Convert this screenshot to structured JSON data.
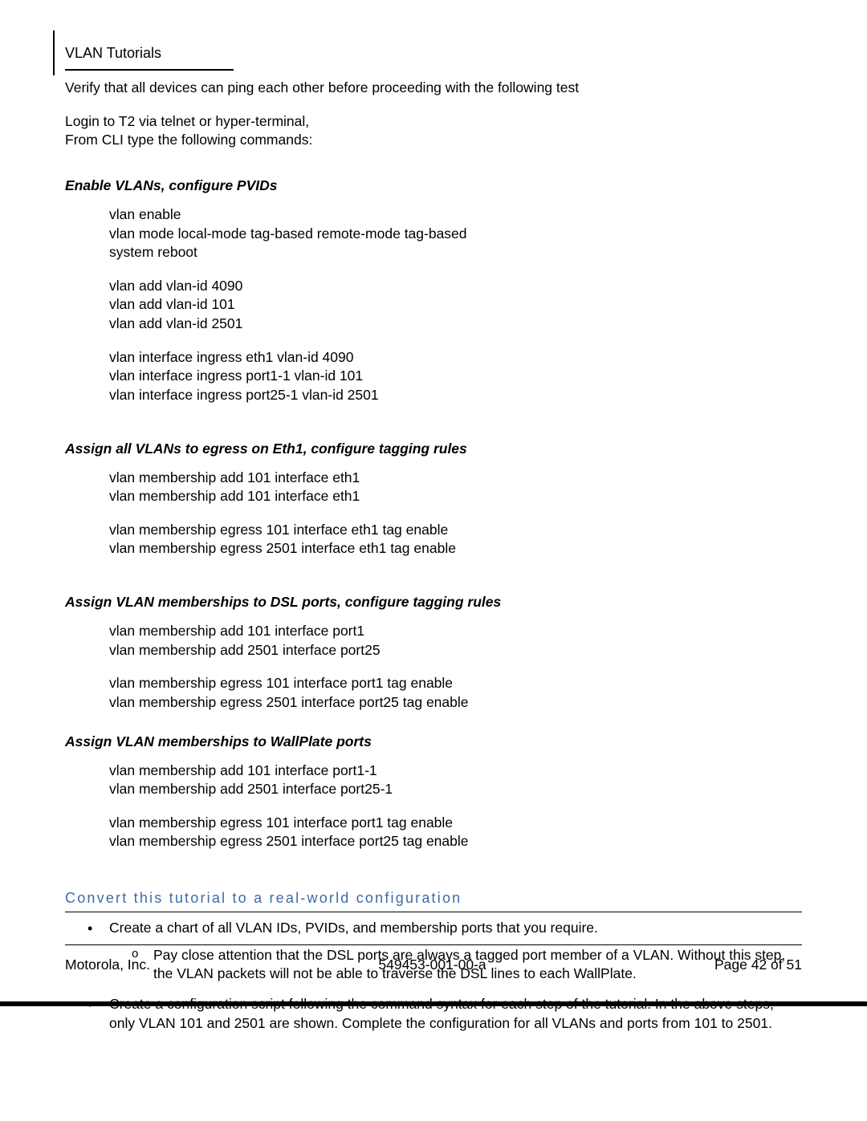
{
  "header": {
    "title": "VLAN Tutorials"
  },
  "intro": {
    "verify": "Verify that all devices can ping each other before proceeding with the following test",
    "login1": "Login to T2 via telnet or hyper-terminal,",
    "login2": "From CLI type the following commands:"
  },
  "sections": [
    {
      "heading": "Enable VLANs, configure PVIDs",
      "blocks": [
        [
          "vlan enable",
          "vlan mode local-mode tag-based remote-mode tag-based",
          "system reboot"
        ],
        [
          "vlan add vlan-id 4090",
          "vlan add vlan-id 101",
          "vlan add vlan-id 2501"
        ],
        [
          "vlan interface ingress eth1 vlan-id 4090",
          "vlan interface ingress port1-1 vlan-id 101",
          "vlan interface ingress port25-1 vlan-id 2501"
        ]
      ]
    },
    {
      "heading": "Assign all VLANs to egress on Eth1, configure tagging rules",
      "blocks": [
        [
          "vlan membership add 101 interface eth1",
          "vlan membership add 101 interface eth1"
        ],
        [
          "vlan membership egress 101 interface eth1 tag enable",
          "vlan membership egress 2501 interface eth1 tag enable"
        ]
      ]
    },
    {
      "heading": "Assign VLAN memberships to DSL ports, configure tagging rules",
      "blocks": [
        [
          "vlan membership add 101 interface port1",
          "vlan membership add 2501 interface port25"
        ],
        [
          "vlan membership egress 101 interface port1 tag enable",
          "vlan membership egress 2501 interface port25 tag enable"
        ]
      ]
    },
    {
      "heading": "Assign VLAN memberships to WallPlate ports",
      "blocks": [
        [
          "vlan membership add 101 interface port1-1",
          "vlan membership add 2501 interface port25-1"
        ],
        [
          "vlan membership egress 101 interface port1 tag enable",
          "vlan membership egress 2501 interface port25 tag enable"
        ]
      ]
    }
  ],
  "convert": {
    "heading": "Convert this tutorial to a real-world configuration",
    "bullets": [
      {
        "text": "Create a chart of all VLAN IDs, PVIDs, and membership ports that you require.",
        "sub": [
          "Pay close attention that the DSL ports are always a tagged port member of a VLAN.  Without this step, the VLAN packets will not be able to traverse the DSL lines to each WallPlate."
        ]
      },
      {
        "text": "Create a configuration script following the command syntax for each step of the tutorial.  In the above steps, only VLAN 101 and 2501 are shown.  Complete the configuration for all VLANs and ports from 101 to 2501.",
        "sub": []
      }
    ]
  },
  "footer": {
    "left": "Motorola, Inc.",
    "center": "549453-001-00-a",
    "right": "Page 42 of 51"
  }
}
